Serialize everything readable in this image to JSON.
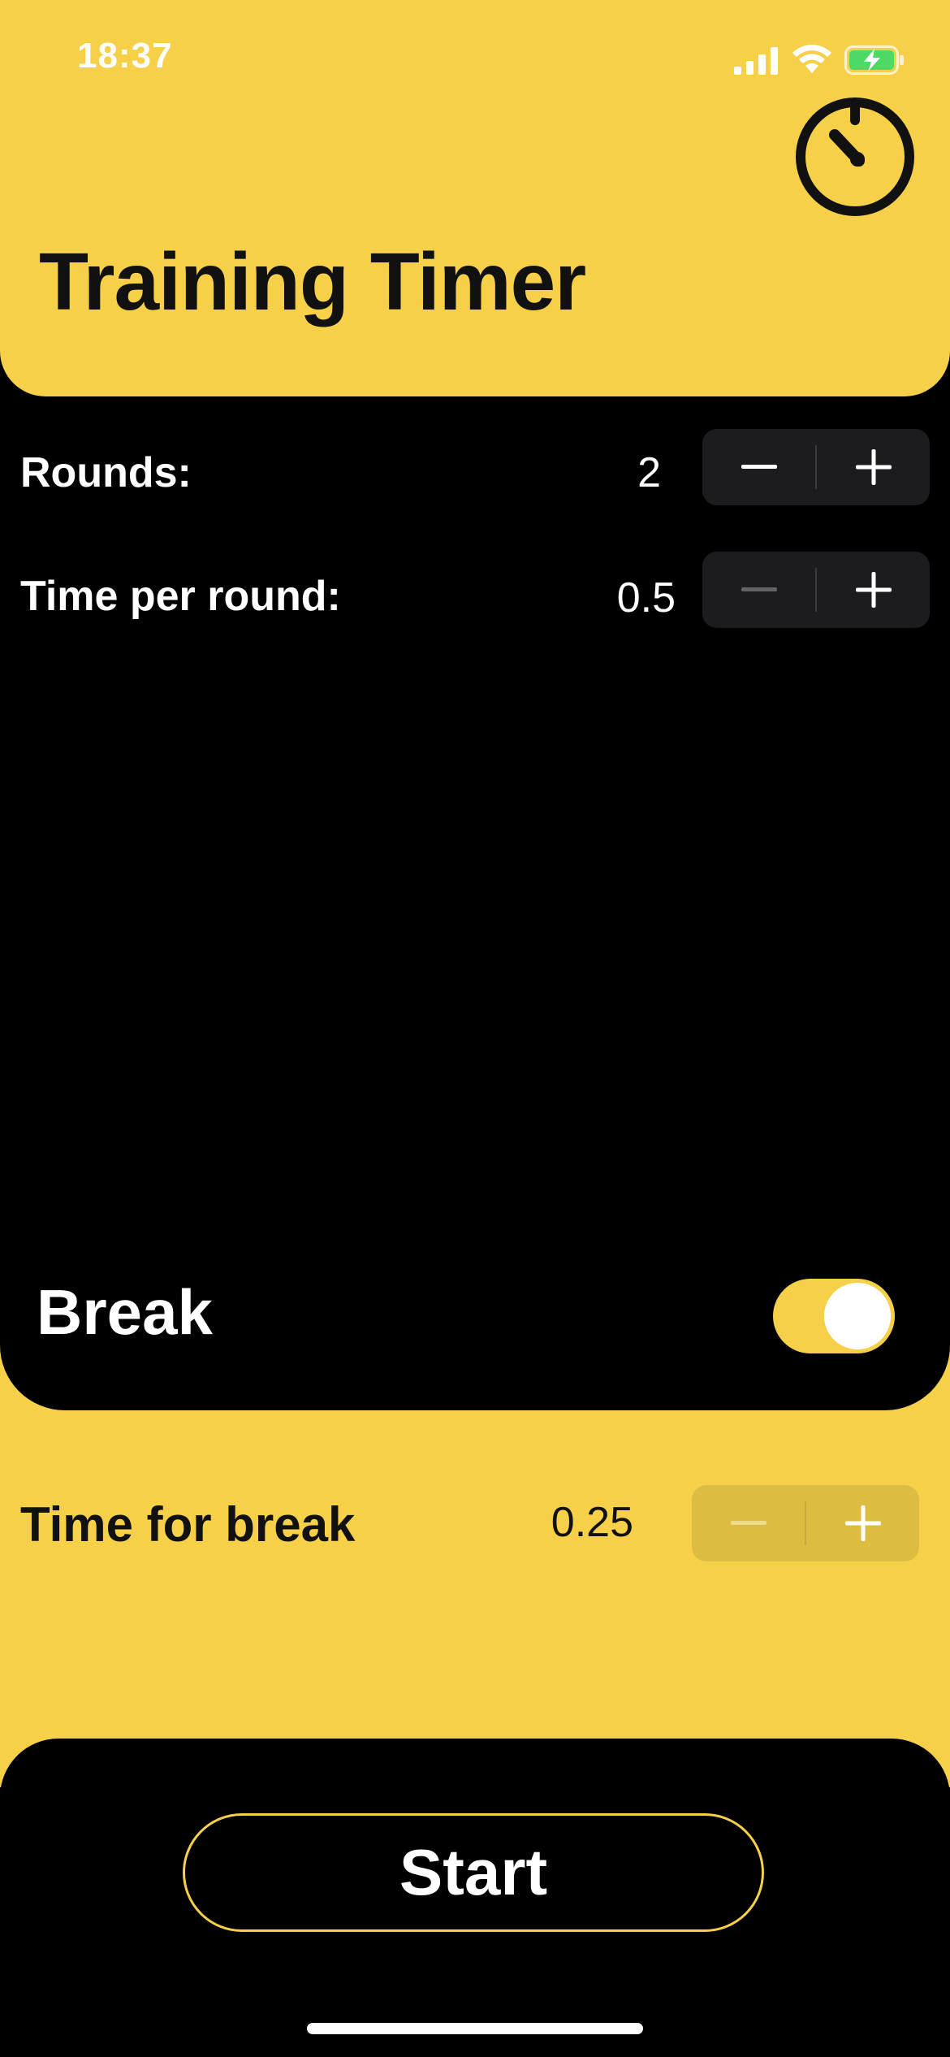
{
  "status_bar": {
    "time": "18:37"
  },
  "header": {
    "title": "Training Timer"
  },
  "settings": {
    "rounds": {
      "label": "Rounds:",
      "value": "2"
    },
    "time_per_round": {
      "label": "Time per round:",
      "value": "0.5"
    }
  },
  "break": {
    "label": "Break",
    "enabled": true,
    "time_label": "Time for break",
    "time_value": "0.25"
  },
  "footer": {
    "start_label": "Start"
  },
  "colors": {
    "accent": "#F7D04A",
    "background": "#000000",
    "stepper": "#1C1C1E"
  },
  "icons": [
    "signal-icon",
    "wifi-icon",
    "battery-charging-icon",
    "timer-icon",
    "minus-icon",
    "plus-icon"
  ]
}
